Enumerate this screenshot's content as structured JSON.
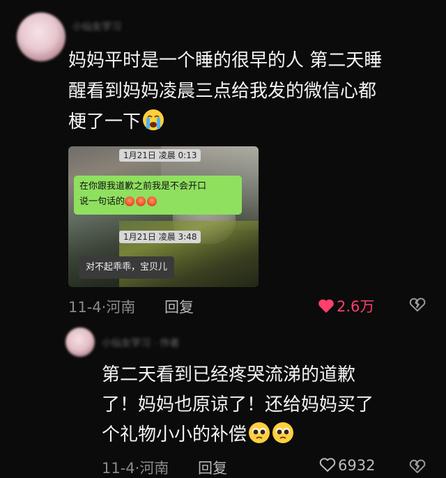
{
  "comment1": {
    "username": "小仙女学习",
    "text_lines": [
      "妈妈平时是一个睡的很早的人 第二天睡",
      "醒看到妈妈凌晨三点给我发的微信心都",
      "梗了一下"
    ],
    "emoji": "crying-face-icon",
    "screenshot": {
      "timestamp1": "1月21日 凌晨 0:13",
      "message1_line1": "在你跟我道歉之前我是不会开口",
      "message1_line2": "说一句话的",
      "timestamp2": "1月21日 凌晨 3:48",
      "message2": "对不起乖乖，宝贝儿"
    },
    "date_location": "11-4·河南",
    "reply_label": "回复",
    "likes": "2.6万",
    "liked": true,
    "like_color": "#ff3f6c"
  },
  "comment2": {
    "username": "小仙女学习 · 作者",
    "text_lines": [
      "第二天看到已经疼哭流涕的道歉",
      "了！妈妈也原谅了！还给妈妈买了",
      "个礼物小小的补偿"
    ],
    "emoji": "pleading-face-icon",
    "date_location": "11-4·河南",
    "reply_label": "回复",
    "likes": "6932",
    "liked": false
  }
}
